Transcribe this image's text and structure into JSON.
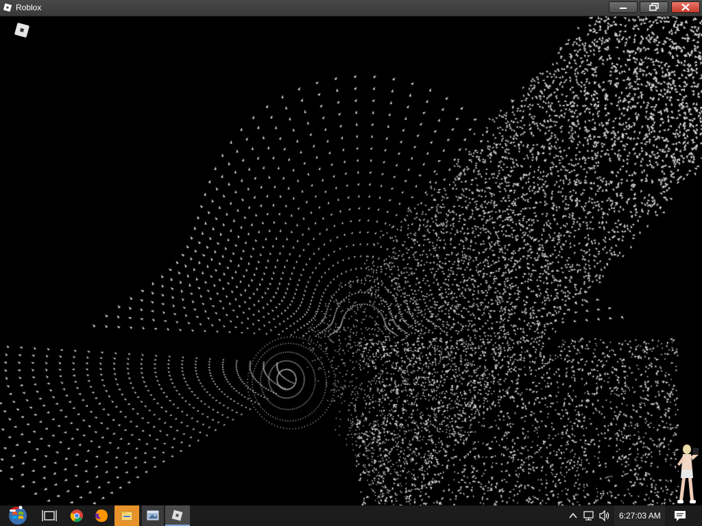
{
  "window": {
    "title": "Roblox",
    "icons": {
      "app": "roblox-icon",
      "minimize": "minimize-icon",
      "maximize": "maximize-icon",
      "close": "close-icon"
    }
  },
  "viewport": {
    "logo_icon": "roblox-logo-icon",
    "scene": "particle-tunnel"
  },
  "taskbar": {
    "items": [
      {
        "name": "start-button",
        "icon": "windows-start-icon"
      },
      {
        "name": "task-view-button",
        "icon": "task-view-icon"
      },
      {
        "name": "chrome-button",
        "icon": "chrome-icon"
      },
      {
        "name": "firefox-button",
        "icon": "firefox-icon"
      },
      {
        "name": "file-explorer-button",
        "icon": "folder-icon"
      },
      {
        "name": "app-button",
        "icon": "app-window-icon"
      },
      {
        "name": "roblox-taskbar-button",
        "icon": "roblox-icon"
      }
    ],
    "tray": {
      "icons": [
        "chevron-up-icon",
        "network-icon",
        "volume-icon"
      ],
      "clock": "6:27:03 AM",
      "notification_icon": "action-center-icon"
    }
  },
  "colors": {
    "titlebar": "#3f3f3f",
    "close": "#c94a3b",
    "taskbar": "#1c1c1c",
    "explorer": "#e8932a",
    "particles": "#d8d8d8"
  }
}
